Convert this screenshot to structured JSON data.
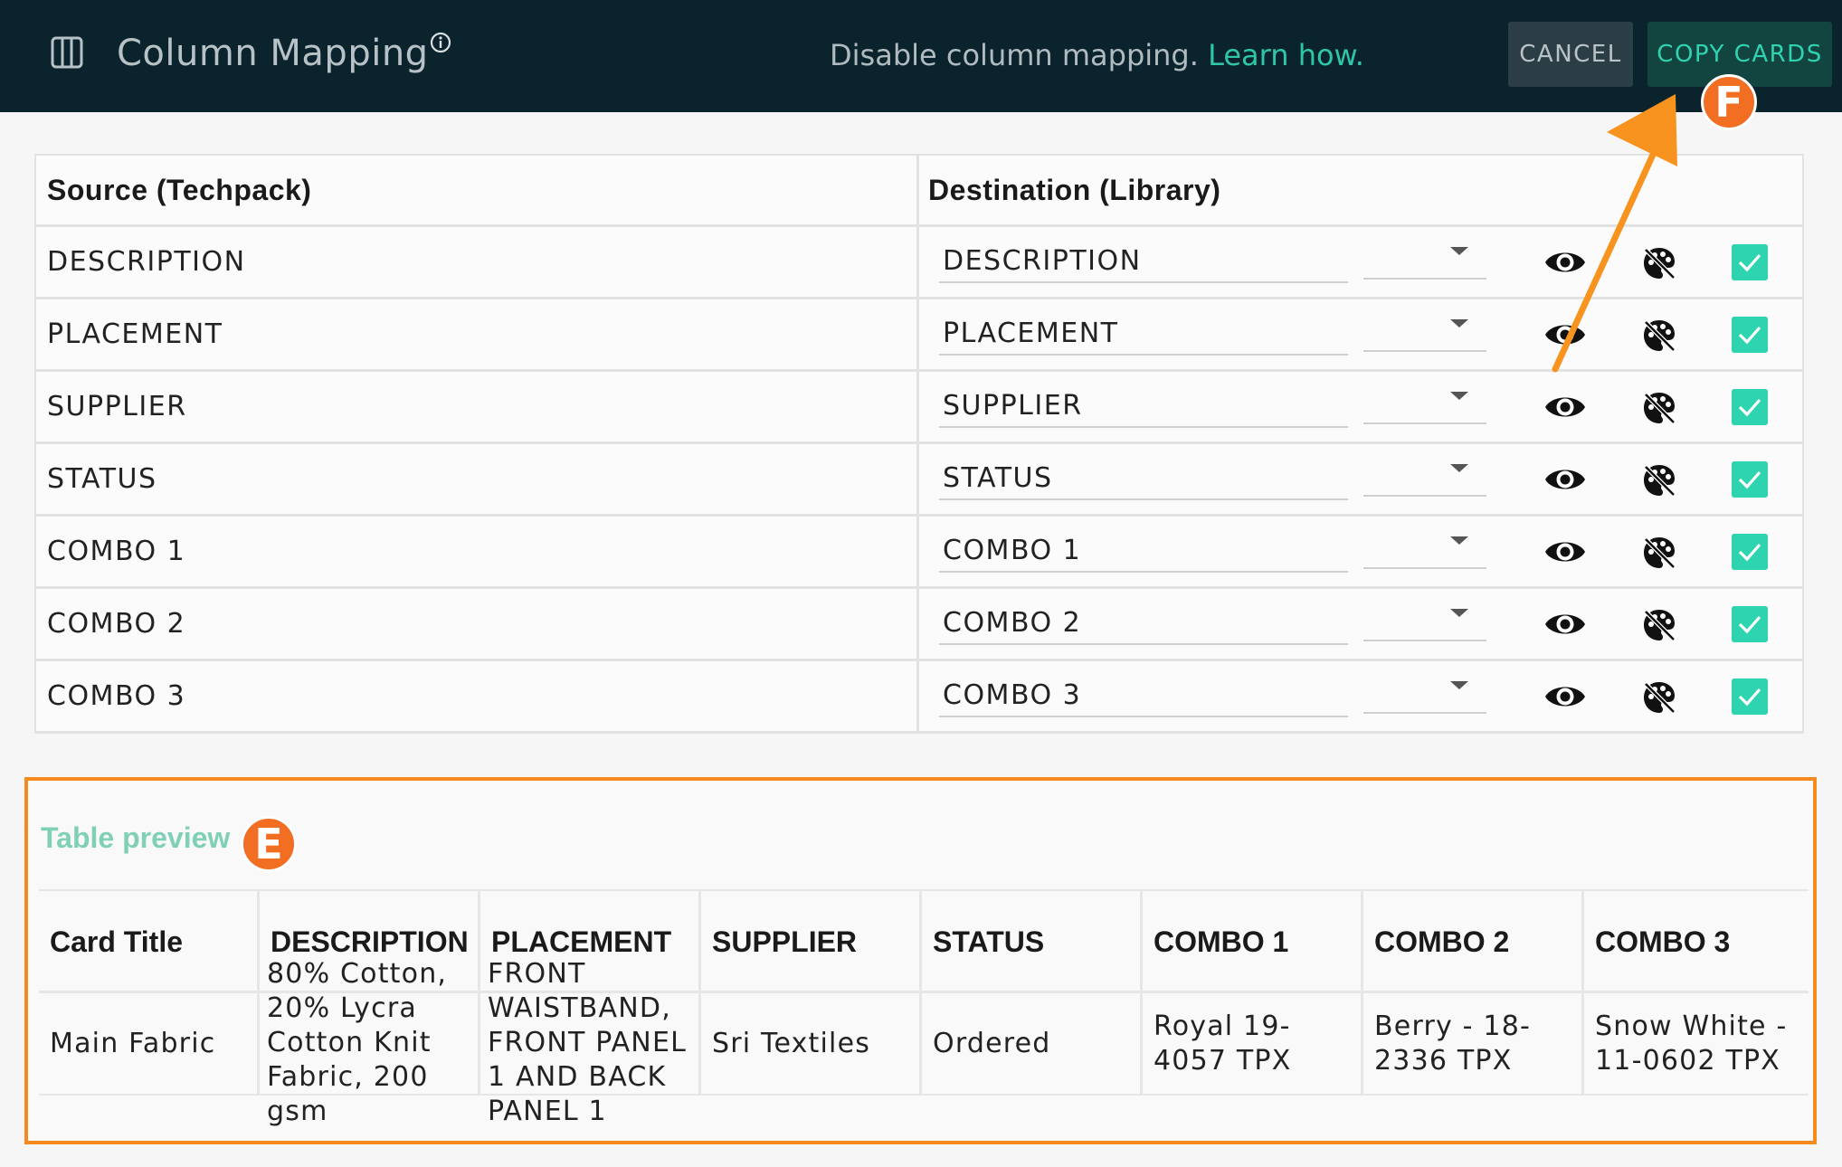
{
  "header": {
    "title": "Column Mapping",
    "disable_text": "Disable column mapping.",
    "learn_link": "Learn how.",
    "cancel_label": "CANCEL",
    "copy_label": "COPY CARDS"
  },
  "markers": {
    "f": "F",
    "e": "E"
  },
  "mapping": {
    "source_header": "Source (Techpack)",
    "destination_header": "Destination (Library)",
    "rows": [
      {
        "source": "DESCRIPTION",
        "destination": "DESCRIPTION"
      },
      {
        "source": "PLACEMENT",
        "destination": "PLACEMENT"
      },
      {
        "source": "SUPPLIER",
        "destination": "SUPPLIER"
      },
      {
        "source": "STATUS",
        "destination": "STATUS"
      },
      {
        "source": "COMBO 1",
        "destination": "COMBO 1"
      },
      {
        "source": "COMBO 2",
        "destination": "COMBO 2"
      },
      {
        "source": "COMBO 3",
        "destination": "COMBO 3"
      }
    ]
  },
  "preview": {
    "title": "Table preview",
    "columns": [
      "Card Title",
      "DESCRIPTION",
      "PLACEMENT",
      "SUPPLIER",
      "STATUS",
      "COMBO 1",
      "COMBO 2",
      "COMBO 3"
    ],
    "row": {
      "card_title": "Main Fabric",
      "description": "80% Cotton, 20% Lycra Cotton Knit Fabric, 200 gsm",
      "placement": "FRONT WAISTBAND, FRONT PANEL 1 AND BACK PANEL 1",
      "supplier": "Sri Textiles",
      "status": "Ordered",
      "combo1": "Royal 19-4057 TPX",
      "combo2": "Berry - 18-2336 TPX",
      "combo3": "Snow White - 11-0602 TPX"
    }
  },
  "colors": {
    "header_bg": "#0a232d",
    "accent": "#2ed3b0",
    "marker": "#f26e22",
    "highlight_border": "#f58a1f"
  },
  "icons": [
    "columns-icon",
    "info-icon",
    "eye-icon",
    "palette-off-icon",
    "checkbox-checked-icon",
    "dropdown-caret-icon"
  ]
}
